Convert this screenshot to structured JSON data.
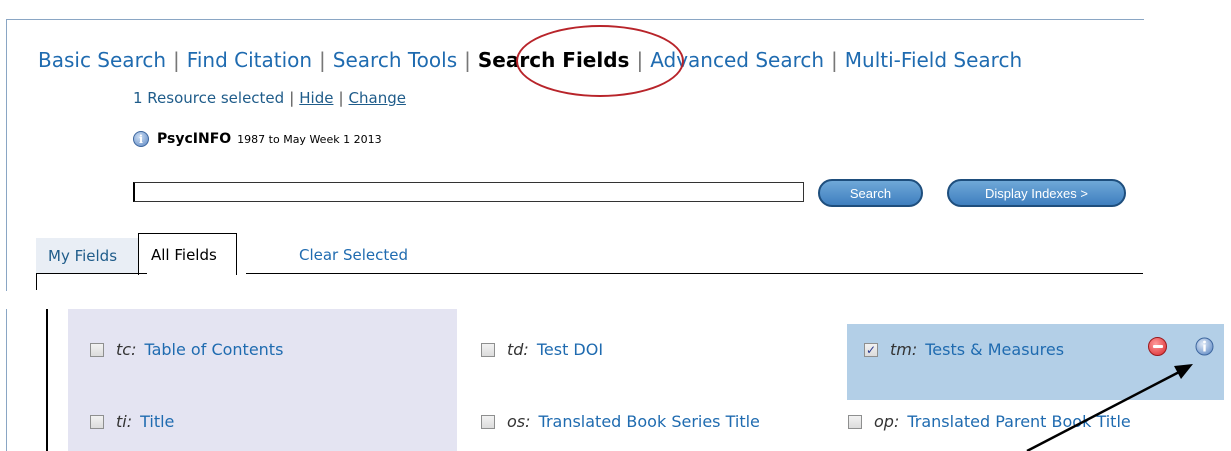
{
  "nav_tabs": [
    {
      "label": "Basic Search",
      "active": false
    },
    {
      "label": "Find Citation",
      "active": false
    },
    {
      "label": "Search Tools",
      "active": false
    },
    {
      "label": "Search Fields",
      "active": true
    },
    {
      "label": "Advanced Search",
      "active": false
    },
    {
      "label": "Multi-Field Search",
      "active": false
    }
  ],
  "resource": {
    "text": "1 Resource selected",
    "hide_label": "Hide",
    "change_label": "Change",
    "separator": "|"
  },
  "database": {
    "name": "PsycINFO",
    "range": "1987 to May Week 1 2013",
    "icon": "info-icon"
  },
  "search": {
    "value": "",
    "placeholder": "",
    "search_button": "Search",
    "display_indexes_button": "Display Indexes >"
  },
  "field_tabs": {
    "my_fields": "My Fields",
    "all_fields": "All Fields",
    "clear_selected": "Clear Selected"
  },
  "fields": [
    {
      "code": "tc:",
      "name": "Table of Contents",
      "checked": false
    },
    {
      "code": "td:",
      "name": "Test DOI",
      "checked": false
    },
    {
      "code": "tm:",
      "name": "Tests & Measures",
      "checked": true
    },
    {
      "code": "ti:",
      "name": "Title",
      "checked": false
    },
    {
      "code": "os:",
      "name": "Translated Book Series Title",
      "checked": false
    },
    {
      "code": "op:",
      "name": "Translated Parent Book Title",
      "checked": false
    }
  ],
  "selected_field_icons": [
    "remove-icon",
    "info-icon"
  ],
  "colors": {
    "link": "#1f6bb0",
    "annotation_circle": "#b8242a",
    "selected_row": "#b3cfe7",
    "lavender_column": "#e4e4f2",
    "button": "#3f7fbf"
  }
}
